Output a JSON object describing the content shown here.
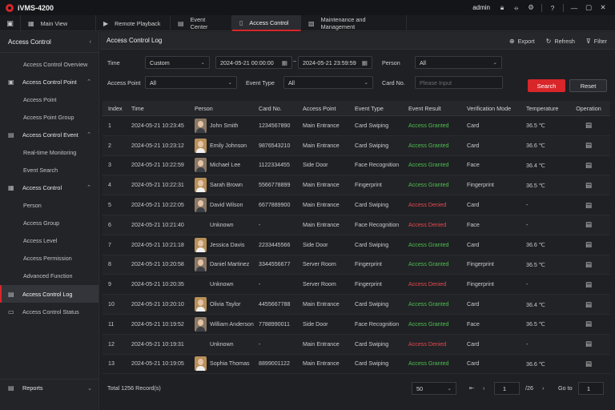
{
  "app": {
    "title": "iVMS-4200",
    "user": "admin"
  },
  "tabs": [
    {
      "label": "Main View",
      "icon": "grid-icon"
    },
    {
      "label": "Remote Playback",
      "icon": "playback-icon"
    },
    {
      "label": "Event Center",
      "icon": "event-icon"
    },
    {
      "label": "Access Control",
      "icon": "door-icon",
      "active": true
    },
    {
      "label": "Maintenance and Management",
      "icon": "maintenance-icon"
    }
  ],
  "sidebar": {
    "header": "Access Control",
    "overview": "Access Control Overview",
    "access_point_group": "Access Control Point",
    "access_point": "Access Point",
    "access_point_group_item": "Access Point Group",
    "event_group": "Access Control Event",
    "realtime": "Real-time Monitoring",
    "event_search": "Event Search",
    "ac_group": "Access Control",
    "person": "Person",
    "access_group": "Access Group",
    "access_level": "Access Level",
    "access_permission": "Access Permission",
    "advanced": "Advanced Function",
    "log": "Access Control Log",
    "status": "Access Control Status",
    "reports": "Reports"
  },
  "page": {
    "title": "Access Control Log",
    "export": "Export",
    "refresh": "Refresh",
    "filter": "Filter"
  },
  "filters": {
    "time_label": "Time",
    "time_mode": "Custom",
    "start": "2024-05-21 00:00:00",
    "end": "2024-05-21 23:59:59",
    "person_label": "Person",
    "person_value": "All",
    "ap_label": "Access Point",
    "ap_value": "All",
    "event_type_label": "Event Type",
    "event_type_value": "All",
    "card_label": "Card No.",
    "card_placeholder": "Please Input",
    "search": "Search",
    "reset": "Reset"
  },
  "table": {
    "headers": [
      "Index",
      "Time",
      "Person",
      "Card No.",
      "Access Point",
      "Event Type",
      "Event Result",
      "Verification Mode",
      "Temperature",
      "Operation"
    ],
    "rows": [
      {
        "index": "1",
        "time": "2024-05-21  10:23:45",
        "person": "John Smith",
        "avatar": "m",
        "card": "1234567890",
        "ap": "Main Entrance",
        "type": "Card Swiping",
        "result": "Access Granted",
        "status": "granted",
        "verif": "Card",
        "temp": "36.5  ℃"
      },
      {
        "index": "2",
        "time": "2024-05-21  10:23:12",
        "person": "Emily Johnson",
        "avatar": "f",
        "card": "9876543210",
        "ap": "Main Entrance",
        "type": "Card Swiping",
        "result": "Access Granted",
        "status": "granted",
        "verif": "Card",
        "temp": "36.6  ℃"
      },
      {
        "index": "3",
        "time": "2024-05-21  10:22:59",
        "person": "Michael Lee",
        "avatar": "m",
        "card": "1122334455",
        "ap": "Side Door",
        "type": "Face Recognition",
        "result": "Access Granted",
        "status": "granted",
        "verif": "Face",
        "temp": "36.4  ℃"
      },
      {
        "index": "4",
        "time": "2024-05-21  10:22:31",
        "person": "Sarah Brown",
        "avatar": "f",
        "card": "5566778899",
        "ap": "Main Entrance",
        "type": "Fingerprint",
        "result": "Access Granted",
        "status": "granted",
        "verif": "Fingerprint",
        "temp": "36.5  ℃"
      },
      {
        "index": "5",
        "time": "2024-05-21  10:22:05",
        "person": "David Wilson",
        "avatar": "m",
        "card": "6677889900",
        "ap": "Main Entrance",
        "type": "Card Swiping",
        "result": "Access Denied",
        "status": "denied",
        "verif": "Card",
        "temp": "-"
      },
      {
        "index": "6",
        "time": "2024-05-21  10:21:40",
        "person": "Unknown",
        "avatar": "",
        "card": "-",
        "ap": "Main Entrance",
        "type": "Face Recognition",
        "result": "Access Denied",
        "status": "denied",
        "verif": "Face",
        "temp": "-"
      },
      {
        "index": "7",
        "time": "2024-05-21  10:21:18",
        "person": "Jessica Davis",
        "avatar": "f",
        "card": "2233445566",
        "ap": "Side Door",
        "type": "Card Swiping",
        "result": "Access Granted",
        "status": "granted",
        "verif": "Card",
        "temp": "36.6  ℃"
      },
      {
        "index": "8",
        "time": "2024-05-21  10:20:58",
        "person": "Daniel Martinez",
        "avatar": "m",
        "card": "3344556677",
        "ap": "Server Room",
        "type": "Fingerprint",
        "result": "Access Granted",
        "status": "granted",
        "verif": "Fingerprint",
        "temp": "36.5  ℃"
      },
      {
        "index": "9",
        "time": "2024-05-21  10:20:35",
        "person": "Unknown",
        "avatar": "",
        "card": "-",
        "ap": "Server Room",
        "type": "Fingerprint",
        "result": "Access Denied",
        "status": "denied",
        "verif": "Fingerprint",
        "temp": "-"
      },
      {
        "index": "10",
        "time": "2024-05-21  10:20:10",
        "person": "Olivia Taylor",
        "avatar": "f",
        "card": "4455667788",
        "ap": "Main Entrance",
        "type": "Card Swiping",
        "result": "Access Granted",
        "status": "granted",
        "verif": "Card",
        "temp": "36.4  ℃"
      },
      {
        "index": "11",
        "time": "2024-05-21  10:19:52",
        "person": "William Anderson",
        "avatar": "m",
        "card": "7788990011",
        "ap": "Side Door",
        "type": "Face Recognition",
        "result": "Access Granted",
        "status": "granted",
        "verif": "Face",
        "temp": "36.5  ℃"
      },
      {
        "index": "12",
        "time": "2024-05-21  10:19:31",
        "person": "Unknown",
        "avatar": "",
        "card": "-",
        "ap": "Main Entrance",
        "type": "Card Swiping",
        "result": "Access Denied",
        "status": "denied",
        "verif": "Card",
        "temp": "-"
      },
      {
        "index": "13",
        "time": "2024-05-21  10:19:05",
        "person": "Sophia Thomas",
        "avatar": "f",
        "card": "8899001122",
        "ap": "Main Entrance",
        "type": "Card Swiping",
        "result": "Access Granted",
        "status": "granted",
        "verif": "Card",
        "temp": "36.6  ℃"
      }
    ]
  },
  "footer": {
    "total": "Total 1256 Record(s)",
    "page_size": "50",
    "first": "⇤",
    "prev": "‹",
    "current_page": "1",
    "total_pages": "/26",
    "next": "›",
    "last": "⇥",
    "goto_label": "Go to",
    "goto_value": "1"
  },
  "colors": {
    "accent": "#d8262a",
    "granted": "#4fbf4f",
    "denied": "#e5484d"
  }
}
